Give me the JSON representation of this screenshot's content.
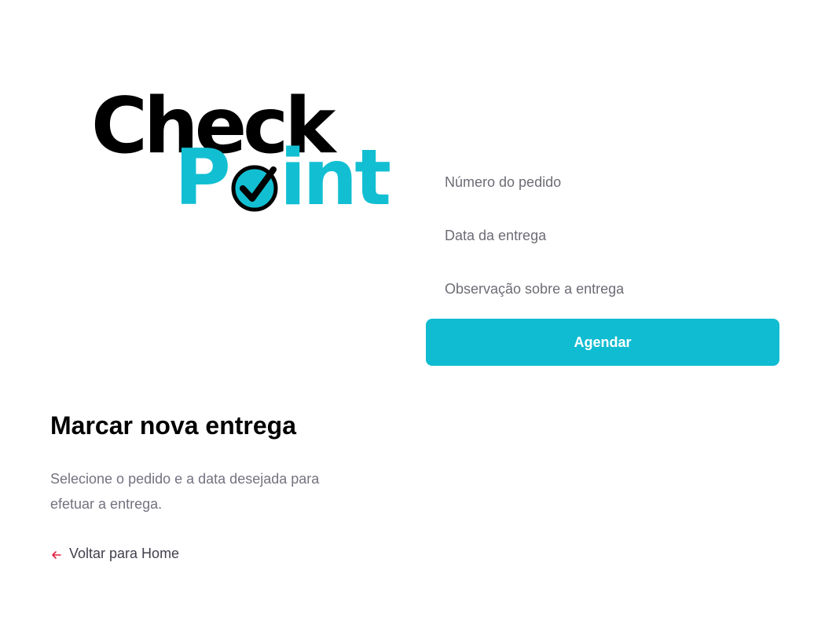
{
  "logo": {
    "word_top": "Check",
    "word_bottom_left": "P",
    "word_bottom_right": "int",
    "colors": {
      "top": "#000000",
      "bottom": "#12bfd2"
    },
    "badge_icon": "checkmark-circle-icon"
  },
  "intro": {
    "title": "Marcar nova entrega",
    "description": "Selecione o pedido e a data desejada para efetuar a entrega.",
    "back_link": {
      "label": "Voltar para Home",
      "icon": "arrow-left-icon",
      "icon_color": "#e02041"
    }
  },
  "form": {
    "order_number": {
      "placeholder": "Número do pedido",
      "value": ""
    },
    "delivery_date": {
      "placeholder": "Data da entrega",
      "value": ""
    },
    "delivery_note": {
      "placeholder": "Observação sobre a entrega",
      "value": ""
    },
    "submit_label": "Agendar",
    "accent_color": "#0fbcd1"
  }
}
